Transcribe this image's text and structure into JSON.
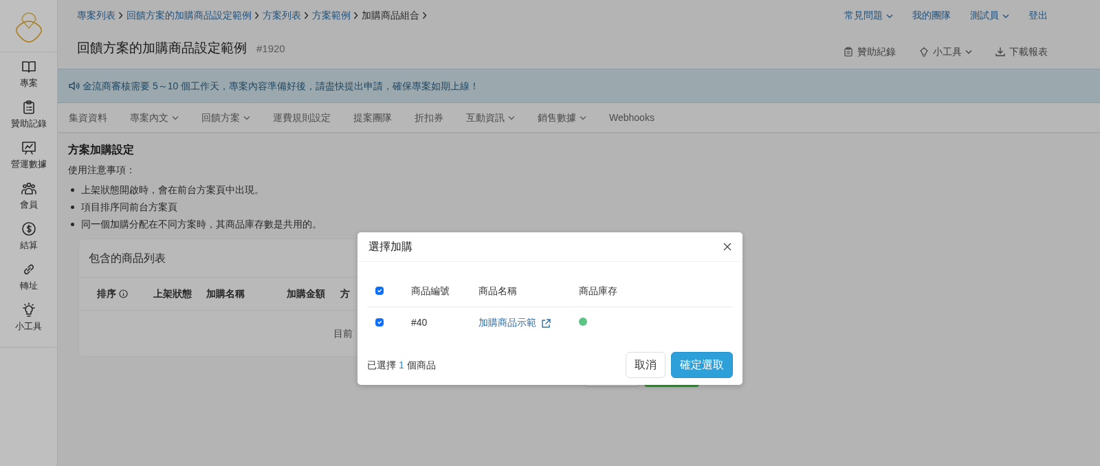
{
  "sidebar": {
    "items": [
      {
        "label": "專案"
      },
      {
        "label": "贊助記錄"
      },
      {
        "label": "營運數據"
      },
      {
        "label": "會員"
      },
      {
        "label": "結算"
      },
      {
        "label": "轉址"
      },
      {
        "label": "小工具"
      }
    ]
  },
  "top_nav": [
    {
      "label": "常見問題",
      "dropdown": true
    },
    {
      "label": "我的團隊",
      "dropdown": false
    },
    {
      "label": "測試員",
      "dropdown": true
    },
    {
      "label": "登出",
      "dropdown": false
    }
  ],
  "breadcrumbs": [
    {
      "label": "專案列表",
      "link": true
    },
    {
      "label": "回饋方案的加購商品設定範例",
      "link": true
    },
    {
      "label": "方案列表",
      "link": true
    },
    {
      "label": "方案範例",
      "link": true
    },
    {
      "label": "加購商品組合",
      "link": false
    }
  ],
  "title": "回饋方案的加購商品設定範例",
  "project_number": "#1920",
  "toolbar": [
    {
      "label": "贊助紀錄",
      "dropdown": false
    },
    {
      "label": "小工具",
      "dropdown": true
    },
    {
      "label": "下載報表",
      "dropdown": false
    }
  ],
  "notice": "金流商審核需要 5～10 個工作天，專案內容準備好後，請盡快提出申請，確保專案如期上線！",
  "tabs": [
    {
      "label": "集資資料",
      "dropdown": false
    },
    {
      "label": "專案內文",
      "dropdown": true
    },
    {
      "label": "回饋方案",
      "dropdown": true
    },
    {
      "label": "運費規則設定",
      "dropdown": false
    },
    {
      "label": "提案團隊",
      "dropdown": false
    },
    {
      "label": "折扣券",
      "dropdown": false
    },
    {
      "label": "互動資訊",
      "dropdown": true
    },
    {
      "label": "銷售數據",
      "dropdown": true
    },
    {
      "label": "Webhooks",
      "dropdown": false
    }
  ],
  "section": {
    "title": "方案加購設定",
    "notes_heading": "使用注意事項：",
    "notes": [
      "上架狀態開啟時，會在前台方案頁中出現。",
      "項目排序同前台方案頁",
      "同一個加購分配在不同方案時，其商品庫存數是共用的。"
    ]
  },
  "product_card": {
    "title": "包含的商品列表",
    "columns": [
      {
        "label": "排序",
        "info": true
      },
      {
        "label": "上架狀態",
        "info": false
      },
      {
        "label": "加購名稱",
        "info": false
      },
      {
        "label": "加購金額",
        "info": false
      },
      {
        "label": "方",
        "info": false
      }
    ],
    "empty_text": "目前"
  },
  "footer_buttons": [
    {
      "kind": "outline"
    },
    {
      "kind": "success"
    }
  ],
  "modal": {
    "title": "選擇加購",
    "select_all": true,
    "columns": [
      "商品編號",
      "商品名稱",
      "商品庫存"
    ],
    "rows": [
      {
        "checked": true,
        "number": "#40",
        "name": "加購商品示範",
        "color": "#5cc586"
      }
    ],
    "summary_prefix": "已選擇",
    "count": "1",
    "summary_suffix": "個商品",
    "buttons": [
      {
        "label": "取消",
        "kind": "secondary"
      },
      {
        "label": "確定選取",
        "kind": "primary"
      }
    ]
  }
}
